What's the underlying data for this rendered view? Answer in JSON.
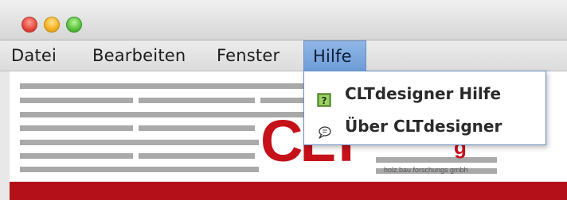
{
  "window": {
    "traffic_lights": [
      "close",
      "minimize",
      "zoom"
    ]
  },
  "menubar": {
    "items": [
      {
        "label": "Datei"
      },
      {
        "label": "Bearbeiten"
      },
      {
        "label": "Fenster"
      },
      {
        "label": "Hilfe"
      }
    ],
    "open_menu": "Hilfe"
  },
  "help_menu": {
    "items": [
      {
        "label": "CLTdesigner Hilfe",
        "icon": "help-book-icon"
      },
      {
        "label": "Über CLTdesigner",
        "icon": "speech-bubble-icon"
      }
    ]
  },
  "logo": {
    "text": "CLT",
    "partial_suffix": "g",
    "subtitle": "holz.bau forschungs gmbh"
  },
  "colors": {
    "accent_red": "#c5111a",
    "menu_highlight": "#7ea8de"
  }
}
